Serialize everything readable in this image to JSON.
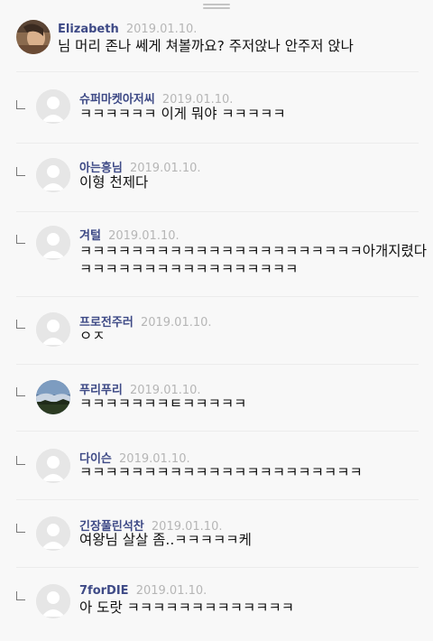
{
  "comments": [
    {
      "name": "Elizabeth",
      "date": "2019.01.10.",
      "text": "님 머리 존나 쎄게 쳐볼까요? 주저앉나 안주저 앉나",
      "reply": false,
      "avatar": "photo-portrait"
    },
    {
      "name": "슈퍼마켓아저씨",
      "date": "2019.01.10.",
      "text": "ㅋㅋㅋㅋㅋㅋ 이게 뭐야 ㅋㅋㅋㅋㅋ",
      "reply": true,
      "avatar": "default-user"
    },
    {
      "name": "아는흥님",
      "date": "2019.01.10.",
      "text": "이형 천제다",
      "reply": true,
      "avatar": "default-user"
    },
    {
      "name": "겨털",
      "date": "2019.01.10.",
      "text": "ㅋㅋㅋㅋㅋㅋㅋㅋㅋㅋㅋㅋㅋㅋㅋㅋㅋㅋㅋㅋㅋㅋ아개지렸다",
      "text2": "ㅋㅋㅋㅋㅋㅋㅋㅋㅋㅋㅋㅋㅋㅋㅋㅋㅋ",
      "reply": true,
      "avatar": "default-user"
    },
    {
      "name": "프로전주러",
      "date": "2019.01.10.",
      "text": "ㅇㅈ",
      "reply": true,
      "avatar": "default-user"
    },
    {
      "name": "푸리푸리",
      "date": "2019.01.10.",
      "text": "ㅋㅋㅋㅋㅋㅋㅋㅌㅋㅋㅋㅋㅋ",
      "reply": true,
      "avatar": "photo-landscape"
    },
    {
      "name": "다이슨",
      "date": "2019.01.10.",
      "text": "ㅋㅋㅋㅋㅋㅋㅋㅋㅋㅋㅋㅋㅋㅋㅋㅋㅋㅋㅋㅋㅋㅋ",
      "reply": true,
      "avatar": "default-user"
    },
    {
      "name": "긴장풀린석찬",
      "date": "2019.01.10.",
      "text": "여왕님 살살 좀..ㅋㅋㅋㅋㅋ케",
      "reply": true,
      "avatar": "default-user"
    },
    {
      "name": "7forDIE",
      "date": "2019.01.10.",
      "text": "아 도랏 ㅋㅋㅋㅋㅋㅋㅋㅋㅋㅋㅋㅋㅋ",
      "reply": true,
      "avatar": "default-user"
    }
  ]
}
